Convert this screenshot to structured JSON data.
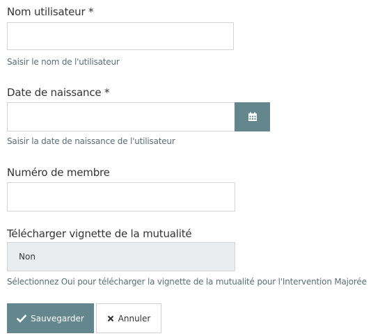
{
  "fields": {
    "username": {
      "label": "Nom utilisateur *",
      "value": "",
      "help": "Saisir le nom de l'utilisateur"
    },
    "birthdate": {
      "label": "Date de naissance *",
      "value": "",
      "help": "Saisir la date de naissance de l'utilisateur",
      "button_icon": "calendar-icon"
    },
    "member_number": {
      "label": "Numéro de membre",
      "value": ""
    },
    "download_vignette": {
      "label": "Télécharger vignette de la mutualité",
      "selected": "Non",
      "help": "Sélectionnez Oui pour télécharger la vignette de la mutualité pour l'Intervention Majorée"
    }
  },
  "actions": {
    "save_label": "Sauvegarder",
    "save_icon": "check-icon",
    "cancel_label": "Annuler",
    "cancel_icon": "close-icon"
  },
  "colors": {
    "accent": "#64868d",
    "select_bg": "#eaedef",
    "help_text": "#5a6e72"
  }
}
